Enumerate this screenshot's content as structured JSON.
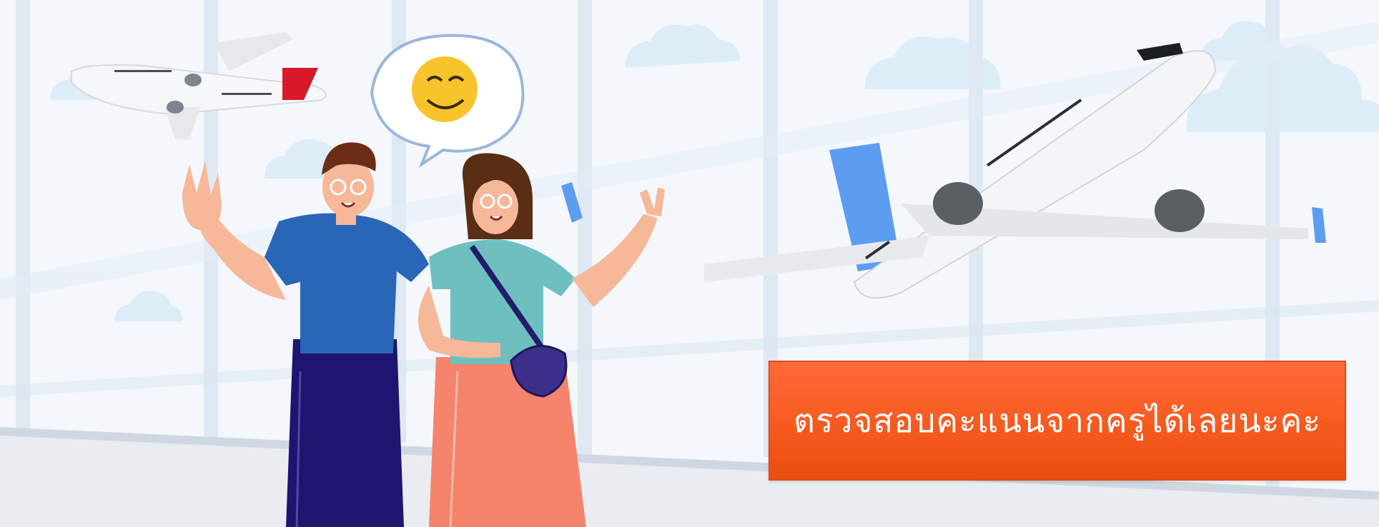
{
  "banner": {
    "cta_label": "ตรวจสอบคะแนนจากครูได้เลยนะคะ"
  },
  "colors": {
    "sky": "#f3f7fb",
    "window_frame": "#dde8f2",
    "floor": "#e9edf2",
    "cta_orange": "#f75a1f",
    "plane_tail_red": "#d8192a",
    "plane_tail_blue": "#5c9df0",
    "shirt_blue": "#2a66b8",
    "pants_navy": "#1d1570",
    "shirt_teal": "#6ec0c0",
    "pants_coral": "#f5846c",
    "emoji_yellow": "#f7c52b"
  },
  "icons": {
    "speech_bubble": "speech-bubble-icon",
    "emoji": "smiling-face-icon"
  }
}
